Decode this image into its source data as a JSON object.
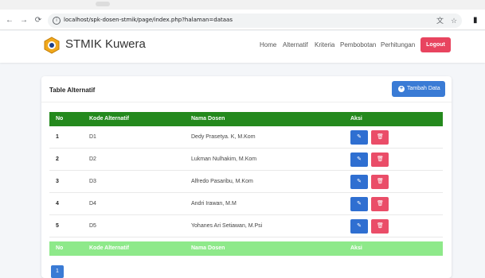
{
  "browser": {
    "url": "localhost/spk-dosen-stmik/page/index.php?halaman=dataas"
  },
  "navbar": {
    "brand": "STMIK Kuwera",
    "menu": [
      "Home",
      "Alternatif",
      "Kriteria",
      "Pembobotan",
      "Perhitungan"
    ],
    "logout_label": "Logout"
  },
  "card": {
    "title": "Table Alternatif",
    "add_label": "Tambah Data"
  },
  "table": {
    "headers": [
      "No",
      "Kode Alternatif",
      "Nama Dosen",
      "Aksi"
    ],
    "rows": [
      {
        "no": "1",
        "kode": "D1",
        "nama": "Dedy Prasetya. K, M.Kom"
      },
      {
        "no": "2",
        "kode": "D2",
        "nama": "Lukman Nulhakim, M.Kom"
      },
      {
        "no": "3",
        "kode": "D3",
        "nama": "Alfredo Pasaribu, M.Kom"
      },
      {
        "no": "4",
        "kode": "D4",
        "nama": "Andri Irawan, M.M"
      },
      {
        "no": "5",
        "kode": "D5",
        "nama": "Yohanes Ari Setiawan, M.Psi"
      }
    ],
    "footer": [
      "No",
      "Kode Alternatif",
      "Nama Dosen",
      "Aksi"
    ]
  },
  "pagination": {
    "current": "1"
  },
  "colors": {
    "table_header": "#24891d",
    "table_footer": "#8ee98a",
    "primary": "#3a7bd5",
    "danger": "#ea4d68"
  },
  "icons": {
    "edit": "edit-icon",
    "delete": "trash-icon",
    "add": "plus-circle-icon"
  }
}
